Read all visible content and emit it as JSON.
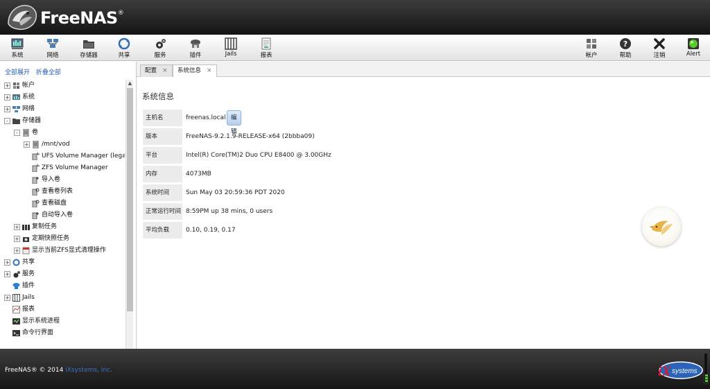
{
  "header": {
    "brand": "FreeNAS",
    "reg_mark": "®"
  },
  "toolbar": {
    "left": [
      {
        "key": "system",
        "label": "系统",
        "icon": "system-icon"
      },
      {
        "key": "network",
        "label": "网络",
        "icon": "network-icon"
      },
      {
        "key": "storage",
        "label": "存储器",
        "icon": "storage-icon"
      },
      {
        "key": "sharing",
        "label": "共享",
        "icon": "sharing-icon"
      },
      {
        "key": "services",
        "label": "服务",
        "icon": "services-icon"
      },
      {
        "key": "plugins",
        "label": "插件",
        "icon": "plugins-icon"
      },
      {
        "key": "jails",
        "label": "Jails",
        "icon": "jails-icon"
      },
      {
        "key": "reports",
        "label": "报表",
        "icon": "reports-icon"
      }
    ],
    "right": [
      {
        "key": "account",
        "label": "帐户",
        "icon": "account-icon"
      },
      {
        "key": "help",
        "label": "帮助",
        "icon": "help-icon"
      },
      {
        "key": "logout",
        "label": "注销",
        "icon": "logout-icon"
      },
      {
        "key": "alert",
        "label": "Alert",
        "icon": "alert-light-icon"
      }
    ]
  },
  "left_panel": {
    "expand_all": "全部展开",
    "collapse_all": "折叠全部",
    "tree": [
      {
        "label": "帐户",
        "icon": "account-icon",
        "toggle": "+"
      },
      {
        "label": "系统",
        "icon": "system-icon",
        "toggle": "+"
      },
      {
        "label": "网络",
        "icon": "network-icon",
        "toggle": "+"
      },
      {
        "label": "存储器",
        "icon": "storage-icon",
        "toggle": "-"
      },
      {
        "label": "卷",
        "icon": "volume-icon",
        "toggle": "-"
      },
      {
        "label": "/mnt/vod",
        "icon": "volume-icon",
        "toggle": "+"
      },
      {
        "label": "UFS Volume Manager (legacy)",
        "icon": "volume-manager-icon",
        "toggle": ""
      },
      {
        "label": "ZFS Volume Manager",
        "icon": "volume-manager-icon",
        "toggle": ""
      },
      {
        "label": "导入卷",
        "icon": "import-volume-icon",
        "toggle": ""
      },
      {
        "label": "查看卷列表",
        "icon": "view-volumes-icon",
        "toggle": ""
      },
      {
        "label": "查看磁盘",
        "icon": "view-disks-icon",
        "toggle": ""
      },
      {
        "label": "自动导入卷",
        "icon": "auto-import-icon",
        "toggle": ""
      },
      {
        "label": "复制任务",
        "icon": "replication-icon",
        "toggle": "+"
      },
      {
        "label": "定期快照任务",
        "icon": "snapshot-icon",
        "toggle": "+"
      },
      {
        "label": "显示当前ZFS显式清理操作",
        "icon": "scrub-icon",
        "toggle": "+"
      },
      {
        "label": "共享",
        "icon": "sharing-icon",
        "toggle": "+"
      },
      {
        "label": "服务",
        "icon": "services-icon",
        "toggle": "+"
      },
      {
        "label": "插件",
        "icon": "plugins-icon",
        "toggle": ""
      },
      {
        "label": "Jails",
        "icon": "jails-icon",
        "toggle": "+"
      },
      {
        "label": "报表",
        "icon": "reports-icon",
        "toggle": ""
      },
      {
        "label": "显示系统进程",
        "icon": "process-icon",
        "toggle": ""
      },
      {
        "label": "命令行界面",
        "icon": "shell-icon",
        "toggle": ""
      }
    ]
  },
  "tabs": [
    {
      "label": "配置",
      "close": "×",
      "active": false
    },
    {
      "label": "系统信息",
      "close": "×",
      "active": true
    }
  ],
  "main": {
    "title": "系统信息",
    "edit_button": "编辑",
    "rows": [
      {
        "label": "主机名",
        "value": "freenas.local"
      },
      {
        "label": "版本",
        "value": "FreeNAS-9.2.1.9-RELEASE-x64 (2bbba09)"
      },
      {
        "label": "平台",
        "value": "Intel(R) Core(TM)2 Duo CPU E8400 @ 3.00GHz"
      },
      {
        "label": "内存",
        "value": "4073MB"
      },
      {
        "label": "系统时间",
        "value": "Sun May 03 20:59:36 PDT 2020"
      },
      {
        "label": "正常运行时间",
        "value": "8:59PM up 38 mins, 0 users"
      },
      {
        "label": "平均负载",
        "value": "0.10, 0.19, 0.17"
      }
    ]
  },
  "footer": {
    "copyright_prefix": "FreeNAS® © 2014 ",
    "company": "iXsystems, Inc.",
    "logo_text": "systems",
    "logo_mark": "iX"
  },
  "colors": {
    "link": "#2a5db0",
    "company": "#3d6fc5",
    "alert_green": "#58c92c"
  }
}
